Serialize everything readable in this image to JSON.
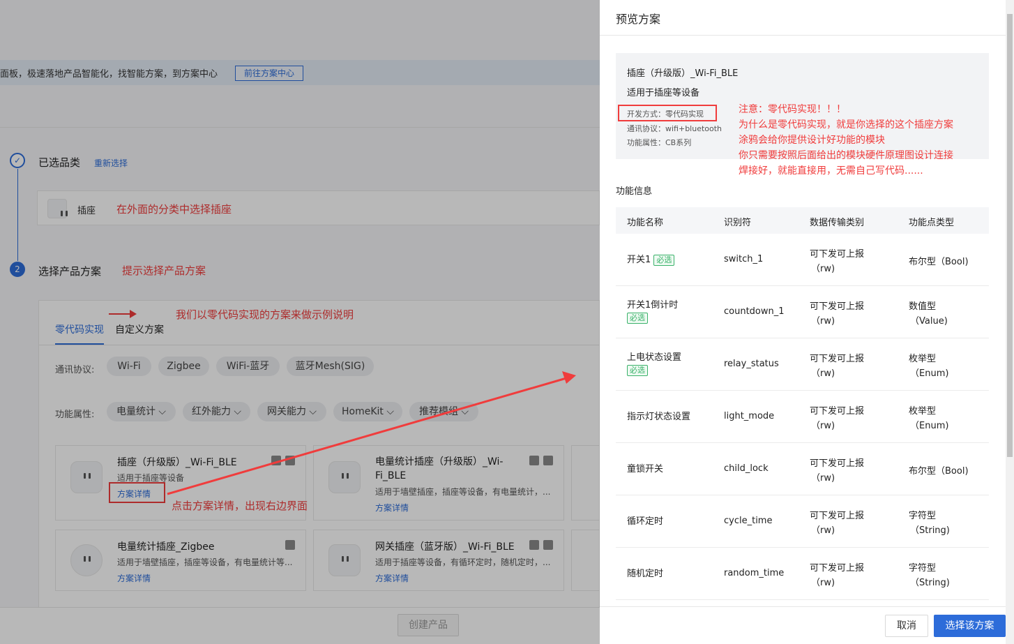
{
  "background": {
    "banner_text": "面板，极速落地产品智能化，找智能方案，到方案中心",
    "banner_button": "前往方案中心",
    "step1": {
      "number": "",
      "title": "已选品类",
      "link": "重新选择"
    },
    "category_item": "插座",
    "note_category": "在外面的分类中选择插座",
    "step2": {
      "number": "2",
      "title": "选择产品方案"
    },
    "note_step2": "提示选择产品方案",
    "note_zero_code": "我们以零代码实现的方案来做示例说明",
    "tabs": [
      "零代码实现",
      "自定义方案"
    ],
    "protocol_label": "通讯协议:",
    "protocols": [
      "Wi-Fi",
      "Zigbee",
      "WiFi-蓝牙",
      "蓝牙Mesh(SIG)"
    ],
    "feature_label": "功能属性:",
    "features": [
      "电量统计",
      "红外能力",
      "网关能力",
      "HomeKit",
      "推荐模组"
    ],
    "cards": [
      {
        "title": "插座（升级版）_Wi-Fi_BLE",
        "desc": "适用于插座等设备",
        "link": "方案详情"
      },
      {
        "title": "电量统计插座（升级版）_Wi-Fi_BLE",
        "desc": "适用于墙壁插座，插座等设备，有电量统计，...",
        "link": "方案详情"
      },
      {
        "title": "电量统计插座_Zigbee",
        "desc": "适用于墙壁插座，插座等设备，有电量统计等...",
        "link": "方案详情"
      },
      {
        "title": "网关插座（蓝牙版）_Wi-Fi_BLE",
        "desc": "适用于插座等设备，有循环定时，随机定时，...",
        "link": "方案详情"
      }
    ],
    "note_click": "点击方案详情，出现右边界面",
    "create_button": "创建产品"
  },
  "drawer": {
    "title": "预览方案",
    "scheme_name": "插座（升级版）_Wi-Fi_BLE",
    "scheme_desc": "适用于插座等设备",
    "dev_mode": "开发方式：零代码实现",
    "protocol": "通讯协议：wifi+bluetooth",
    "attribute": "功能属性：CB系列",
    "note_lines": [
      "注意：零代码实现！！！",
      "为什么是零代码实现，就是你选择的这个插座方案",
      "涂鸦会给你提供设计好功能的模块",
      "你只需要按照后面给出的模块硬件原理图设计连接",
      "焊接好，就能直接用，无需自己写代码......"
    ],
    "section_title": "功能信息",
    "columns": [
      "功能名称",
      "识别符",
      "数据传输类别",
      "功能点类型"
    ],
    "required_tag": "必选",
    "rows": [
      {
        "name": "开关1",
        "required": true,
        "id": "switch_1",
        "transfer1": "可下发可上报",
        "transfer2": "（rw)",
        "type1": "布尔型（Bool)",
        "type2": ""
      },
      {
        "name": "开关1倒计时",
        "required": true,
        "id": "countdown_1",
        "transfer1": "可下发可上报",
        "transfer2": "（rw)",
        "type1": "数值型",
        "type2": "（Value)"
      },
      {
        "name": "上电状态设置",
        "required": true,
        "id": "relay_status",
        "transfer1": "可下发可上报",
        "transfer2": "（rw)",
        "type1": "枚举型",
        "type2": "（Enum)"
      },
      {
        "name": "指示灯状态设置",
        "required": false,
        "id": "light_mode",
        "transfer1": "可下发可上报",
        "transfer2": "（rw)",
        "type1": "枚举型",
        "type2": "（Enum)"
      },
      {
        "name": "童锁开关",
        "required": false,
        "id": "child_lock",
        "transfer1": "可下发可上报",
        "transfer2": "（rw)",
        "type1": "布尔型（Bool)",
        "type2": ""
      },
      {
        "name": "循环定时",
        "required": false,
        "id": "cycle_time",
        "transfer1": "可下发可上报",
        "transfer2": "（rw)",
        "type1": "字符型",
        "type2": "（String)"
      },
      {
        "name": "随机定时",
        "required": false,
        "id": "random_time",
        "transfer1": "可下发可上报",
        "transfer2": "（rw)",
        "type1": "字符型",
        "type2": "（String)"
      }
    ],
    "cancel_button": "取消",
    "select_button": "选择该方案"
  },
  "colors": {
    "accent": "#2d6cd9",
    "annotation": "#f03c3c",
    "tag_green": "#3ab26a"
  }
}
